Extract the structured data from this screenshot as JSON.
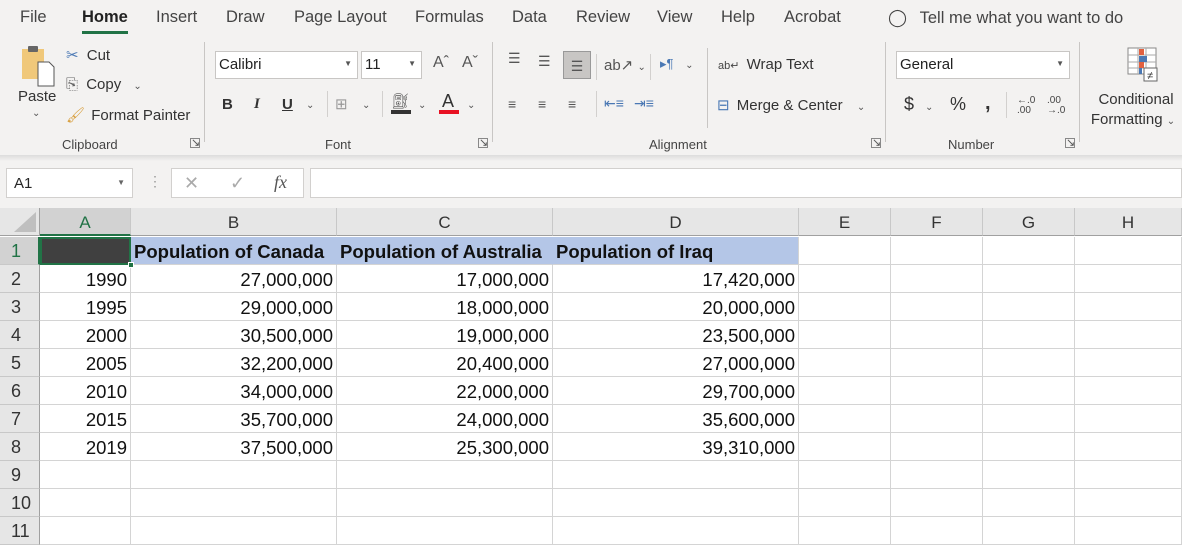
{
  "menu": {
    "tabs": [
      "File",
      "Home",
      "Insert",
      "Draw",
      "Page Layout",
      "Formulas",
      "Data",
      "Review",
      "View",
      "Help",
      "Acrobat"
    ],
    "active_tab": "Home",
    "tell_me": "Tell me what you want to do"
  },
  "ribbon": {
    "clipboard": {
      "paste": "Paste",
      "cut": "Cut",
      "copy": "Copy",
      "format_painter": "Format Painter",
      "label": "Clipboard"
    },
    "font": {
      "font_name": "Calibri",
      "font_size": "11",
      "bold": "B",
      "italic": "I",
      "underline": "U",
      "label": "Font",
      "font_color": "#e81123",
      "fill_color": "#333333"
    },
    "alignment": {
      "wrap_text": "Wrap Text",
      "merge_center": "Merge & Center",
      "label": "Alignment"
    },
    "number": {
      "format": "General",
      "currency": "$",
      "percent": "%",
      "comma": ",",
      "label": "Number"
    },
    "styles": {
      "conditional_formatting_line1": "Conditional",
      "conditional_formatting_line2": "Formatting"
    }
  },
  "formula_bar": {
    "name_box": "A1",
    "cancel": "✕",
    "enter": "✓",
    "fx": "fx",
    "formula": ""
  },
  "sheet": {
    "columns": [
      "A",
      "B",
      "C",
      "D",
      "E",
      "F",
      "G",
      "H"
    ],
    "selected_cell": "A1",
    "row_numbers": [
      "1",
      "2",
      "3",
      "4",
      "5",
      "6",
      "7",
      "8",
      "9",
      "10",
      "11"
    ],
    "header_row": [
      "",
      "Population of Canada",
      "Population of Australia",
      "Population of Iraq"
    ],
    "header_fill": "#b4c6e7",
    "rows": [
      [
        "1990",
        "27,000,000",
        "17,000,000",
        "17,420,000"
      ],
      [
        "1995",
        "29,000,000",
        "18,000,000",
        "20,000,000"
      ],
      [
        "2000",
        "30,500,000",
        "19,000,000",
        "23,500,000"
      ],
      [
        "2005",
        "32,200,000",
        "20,400,000",
        "27,000,000"
      ],
      [
        "2010",
        "34,000,000",
        "22,000,000",
        "29,700,000"
      ],
      [
        "2015",
        "35,700,000",
        "24,000,000",
        "35,600,000"
      ],
      [
        "2019",
        "37,500,000",
        "25,300,000",
        "39,310,000"
      ]
    ]
  }
}
